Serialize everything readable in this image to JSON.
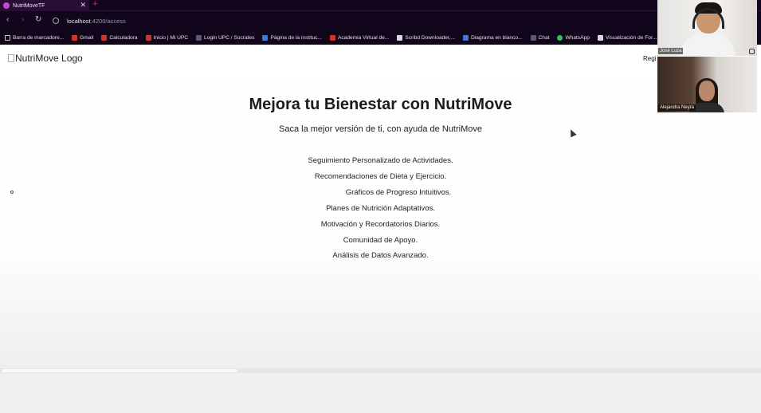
{
  "browser": {
    "tab_title": "NutriMoveTF",
    "tab_close": "✕",
    "new_tab": "+",
    "url_host": "localhost",
    "url_path": ":4200/access",
    "nav": {
      "back": "‹",
      "forward": "›",
      "reload": "↻"
    },
    "bookmarks": [
      {
        "label": "Barra de marcadore...",
        "icon": "folder-icon"
      },
      {
        "label": "Gmail",
        "icon": "gmail-icon"
      },
      {
        "label": "Calculadora",
        "icon": "calculator-icon"
      },
      {
        "label": "Inicio | Mi UPC",
        "icon": "upc-icon"
      },
      {
        "label": "Login UPC / Socrates",
        "icon": "user-icon"
      },
      {
        "label": "Página de la instituc...",
        "icon": "institution-icon"
      },
      {
        "label": "Academia Virtual de...",
        "icon": "academy-icon"
      },
      {
        "label": "Scribd Downloader,...",
        "icon": "scribd-icon"
      },
      {
        "label": "Diagrama en blanco...",
        "icon": "diagram-icon"
      },
      {
        "label": "Chat",
        "icon": "chat-icon"
      },
      {
        "label": "WhatsApp",
        "icon": "whatsapp-icon"
      },
      {
        "label": "Visualización de For...",
        "icon": "document-icon"
      }
    ]
  },
  "header": {
    "logo_alt": "NutriMove Logo",
    "register_label": "Regi"
  },
  "hero": {
    "title": "Mejora tu Bienestar con NutriMove",
    "subtitle": "Saca la mejor versión de ti, con ayuda de NutriMove"
  },
  "features": [
    "Seguimiento Personalizado de Actividades.",
    "Recomendaciones de Dieta y Ejercicio.",
    "Gráficos de Progreso Intuitivos.",
    "Planes de Nutrición Adaptativos.",
    "Motivación y Recordatorios Diarios.",
    "Comunidad de Apoyo.",
    "Análisis de Datos Avanzado."
  ],
  "video_call": {
    "participants": [
      {
        "name": "José Luza"
      },
      {
        "name": "Alejandra Neyra"
      }
    ]
  },
  "colors": {
    "browser_bg": "#12061c",
    "tab_accent": "#e0315a",
    "page_bg": "#ffffff"
  }
}
